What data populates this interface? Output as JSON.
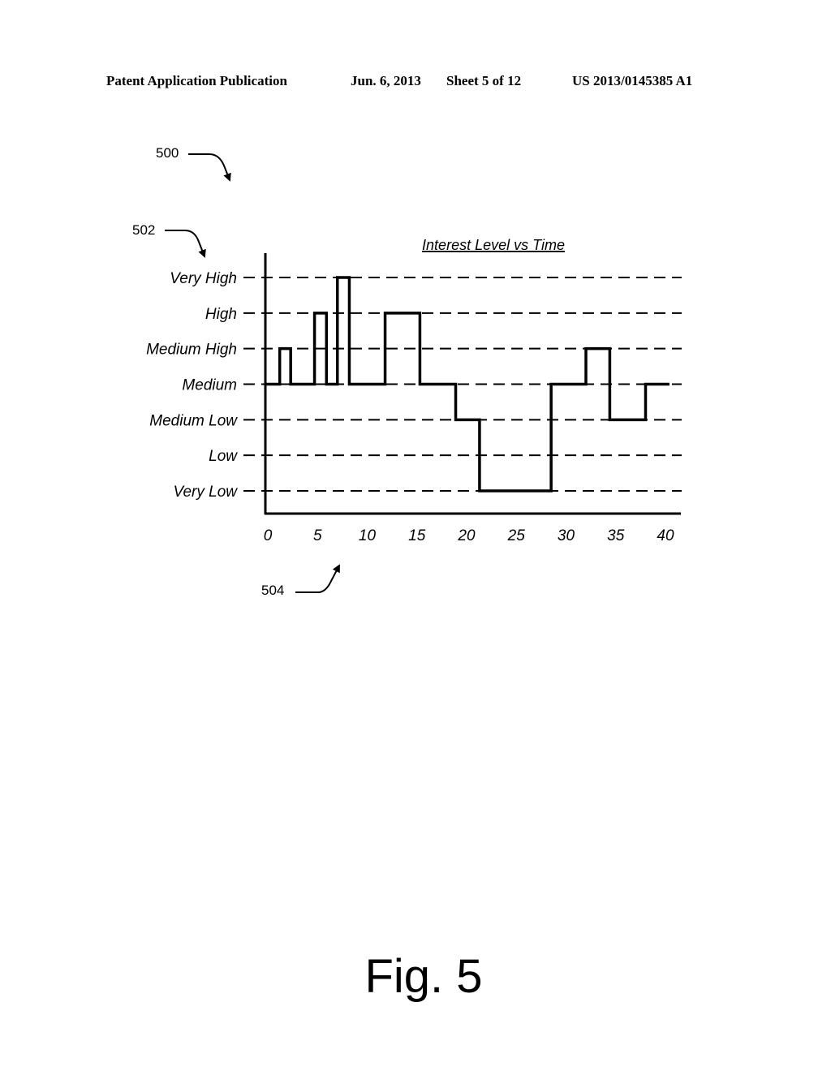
{
  "header": {
    "publication": "Patent Application Publication",
    "date": "Jun. 6, 2013",
    "sheet": "Sheet 5 of 12",
    "number": "US 2013/0145385 A1"
  },
  "references": {
    "figure_ref": "500",
    "y_axis_ref": "502",
    "x_axis_ref": "504"
  },
  "figure_label": "Fig. 5",
  "chart_data": {
    "type": "line",
    "step": true,
    "title": "Interest Level vs Time",
    "xlabel": "",
    "ylabel": "",
    "x_ticks": [
      0,
      5,
      10,
      15,
      20,
      25,
      30,
      35,
      40
    ],
    "x_tick_labels": [
      "0",
      "5",
      "10",
      "15",
      "20",
      "25",
      "30",
      "35",
      "40"
    ],
    "xlim": [
      0,
      40
    ],
    "y_categories": [
      "Very Low",
      "Low",
      "Medium Low",
      "Medium",
      "Medium High",
      "High",
      "Very High"
    ],
    "y_tick_labels_top_to_bottom": [
      "Very High",
      "High",
      "Medium High",
      "Medium",
      "Medium Low",
      "Low",
      "Very Low"
    ],
    "grid": "horizontal-dashed",
    "series": [
      {
        "name": "Interest Level",
        "x": [
          0,
          1.2,
          2.3,
          4.7,
          5.9,
          7.0,
          8.2,
          11.8,
          15.3,
          18.9,
          21.3,
          28.5,
          32.0,
          34.4,
          38.0,
          40.4
        ],
        "values": [
          "Medium",
          "Medium High",
          "Medium",
          "High",
          "Medium",
          "Very High",
          "Medium",
          "High",
          "Medium",
          "Medium Low",
          "Very Low",
          "Medium",
          "Medium High",
          "Medium Low",
          "Medium",
          "Medium"
        ]
      }
    ]
  }
}
